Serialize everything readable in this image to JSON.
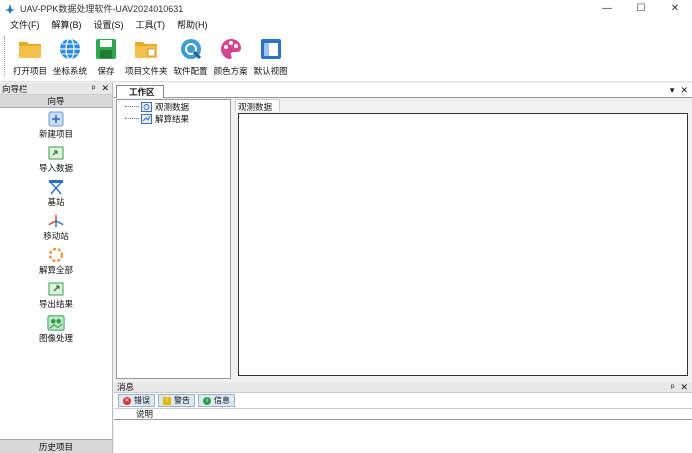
{
  "window": {
    "title": "UAV-PPK数据处理软件-UAV2024010631",
    "controls": {
      "minimize": "—",
      "maximize": "☐",
      "close": "✕"
    }
  },
  "menu": [
    {
      "label": "文件(F)"
    },
    {
      "label": "解算(B)"
    },
    {
      "label": "设置(S)"
    },
    {
      "label": "工具(T)"
    },
    {
      "label": "帮助(H)"
    }
  ],
  "toolbar": [
    {
      "label": "打开项目",
      "icon": "folder-open-icon"
    },
    {
      "label": "坐标系统",
      "icon": "globe-icon"
    },
    {
      "label": "保存",
      "icon": "save-icon"
    },
    {
      "label": "项目文件夹",
      "icon": "project-folder-icon"
    },
    {
      "label": "软件配置",
      "icon": "settings-config-icon"
    },
    {
      "label": "颜色方案",
      "icon": "palette-icon"
    },
    {
      "label": "默认视图",
      "icon": "default-view-icon"
    }
  ],
  "nav": {
    "header": "向导栏",
    "pin": "ᵖ",
    "close": "✕",
    "section": "向导",
    "items": [
      {
        "label": "新建项目",
        "icon": "new-project-icon"
      },
      {
        "label": "导入数据",
        "icon": "import-data-icon"
      },
      {
        "label": "基站",
        "icon": "base-station-icon"
      },
      {
        "label": "移动站",
        "icon": "rover-icon"
      },
      {
        "label": "解算全部",
        "icon": "solve-all-icon"
      },
      {
        "label": "导出结果",
        "icon": "export-result-icon"
      },
      {
        "label": "图像处理",
        "icon": "image-processing-icon"
      }
    ],
    "history": "历史项目"
  },
  "workspace": {
    "tab": "工作区",
    "dropdown": "▾",
    "close": "✕",
    "tree": [
      {
        "label": "观测数据",
        "icon": "observation-data-icon"
      },
      {
        "label": "解算结果",
        "icon": "solve-result-icon"
      }
    ],
    "data_title": "观测数据"
  },
  "messages": {
    "header": "消息",
    "pin": "ᵖ",
    "close": "✕",
    "filters": [
      {
        "label": "错误",
        "icon": "error-icon",
        "color": "#d9342b"
      },
      {
        "label": "警告",
        "icon": "warning-icon",
        "color": "#e6b800"
      },
      {
        "label": "信息",
        "icon": "info-icon",
        "color": "#2e9e4a"
      }
    ],
    "column": "说明"
  }
}
